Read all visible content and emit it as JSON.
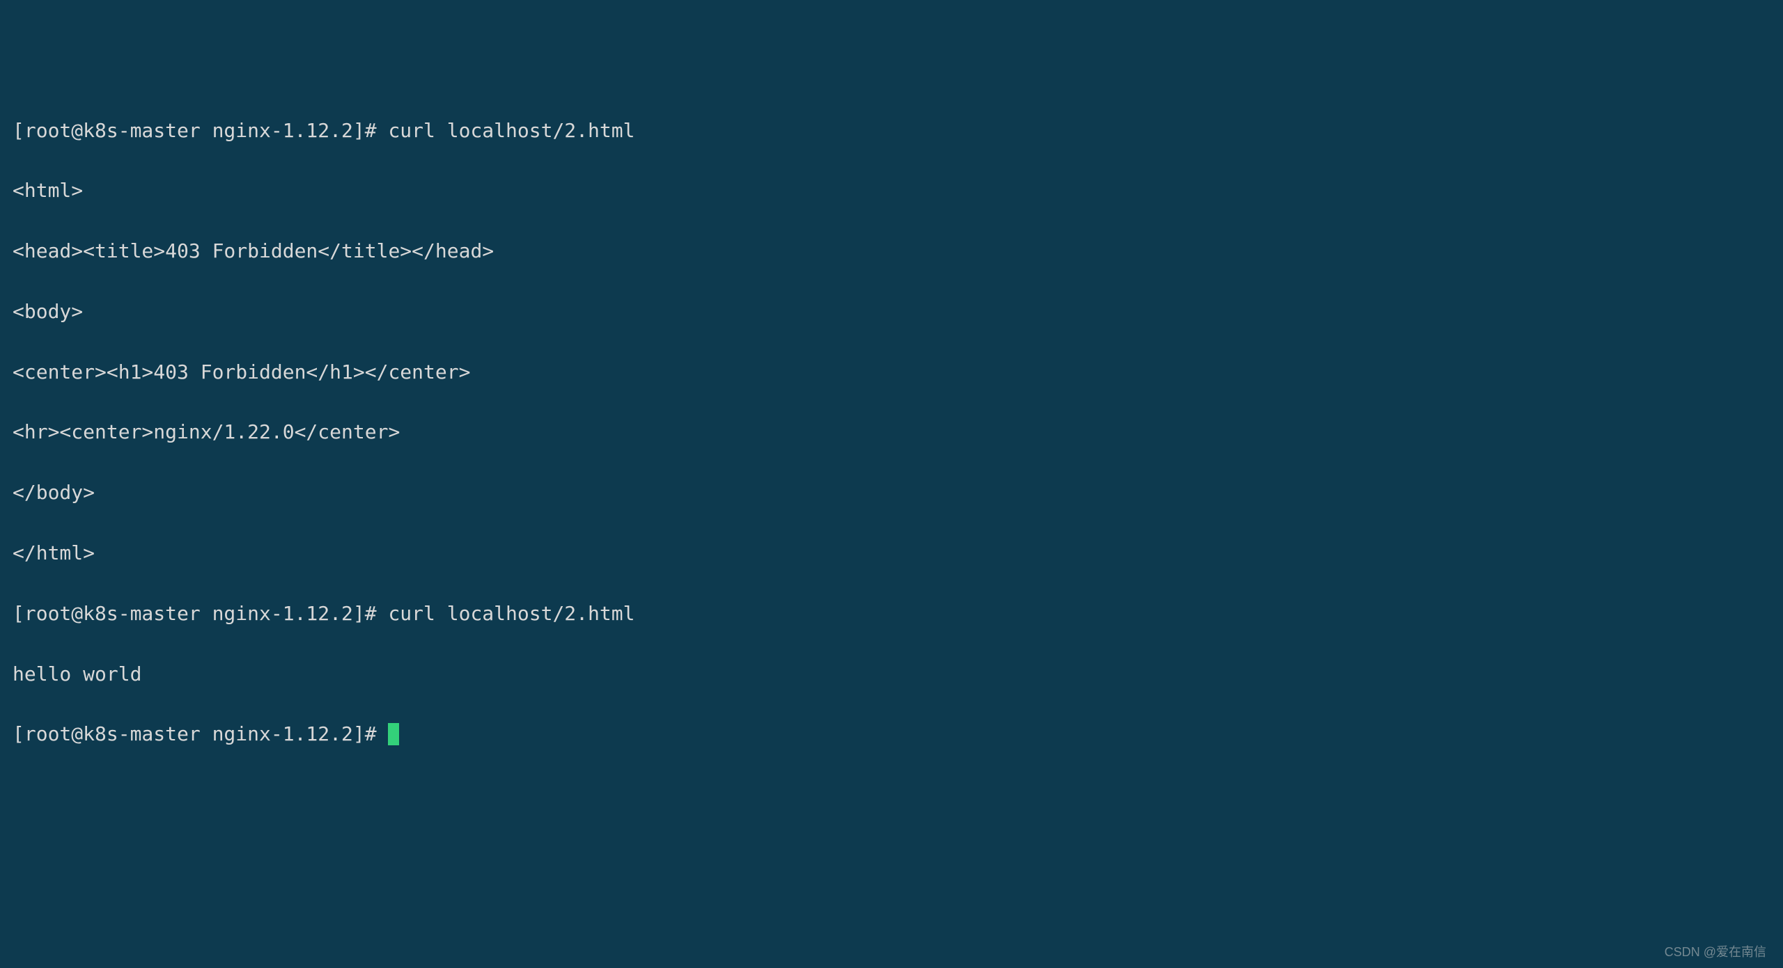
{
  "terminal": {
    "lines": {
      "l0": "[root@k8s-master nginx-1.12.2]# curl localhost/2.html",
      "l1": "<html>",
      "l2": "<head><title>403 Forbidden</title></head>",
      "l3": "<body>",
      "l4": "<center><h1>403 Forbidden</h1></center>",
      "l5": "<hr><center>nginx/1.22.0</center>",
      "l6": "</body>",
      "l7": "</html>",
      "l8": "[root@k8s-master nginx-1.12.2]# curl localhost/2.html",
      "l9": "hello world",
      "l10": "[root@k8s-master nginx-1.12.2]# "
    },
    "watermark": "CSDN @爱在南信",
    "colors": {
      "background": "#0d3a4f",
      "text": "#d8d8d8",
      "cursor": "#33d17a"
    }
  }
}
